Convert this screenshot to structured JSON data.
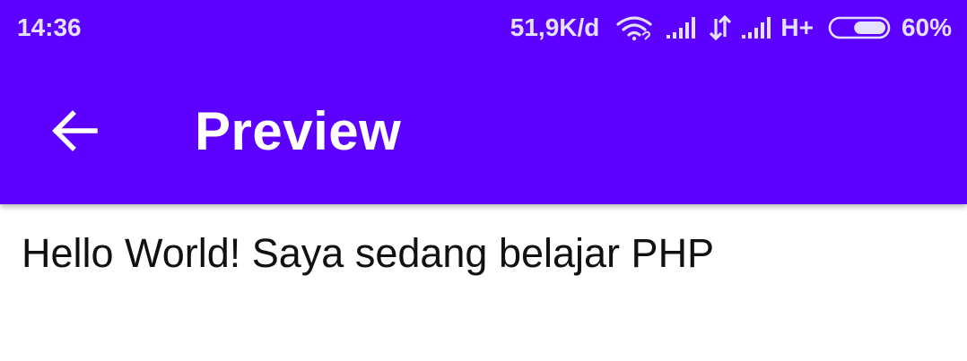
{
  "status_bar": {
    "time": "14:36",
    "network_speed": "51,9K/d",
    "network_type": "H+",
    "battery_percent": "60%",
    "battery_level": 0.6,
    "icons": [
      "wifi-icon",
      "signal-strength-icon",
      "data-sync-icon",
      "signal-strength-icon",
      "battery-icon"
    ]
  },
  "app_bar": {
    "title": "Preview",
    "back_icon": "arrow-left-icon"
  },
  "content": {
    "text": "Hello World! Saya sedang belajar PHP"
  },
  "colors": {
    "app_bar": "#5c00ff",
    "status_text": "#e6e0ff",
    "title_text": "#ffffff",
    "body_text": "#111111",
    "background": "#ffffff"
  }
}
